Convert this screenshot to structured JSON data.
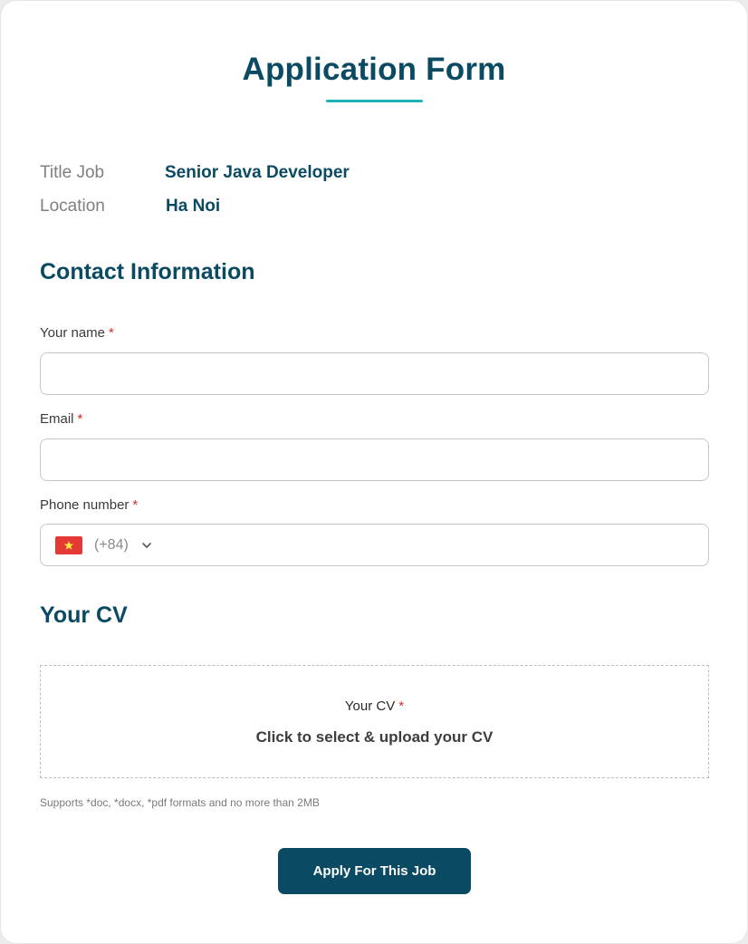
{
  "header": {
    "title": "Application Form"
  },
  "job": {
    "title_label": "Title Job",
    "title_value": "Senior Java Developer",
    "location_label": "Location",
    "location_value": "Ha Noi"
  },
  "contact": {
    "heading": "Contact Information",
    "name_label": "Your name",
    "email_label": "Email",
    "phone_label": "Phone number",
    "required_mark": "*",
    "name_value": "",
    "email_value": "",
    "phone_value": "",
    "country_flag": "vietnam-flag-icon",
    "dial_code": "(+84)"
  },
  "cv": {
    "heading": "Your CV",
    "upload_label": "Your CV",
    "upload_cta": "Click to select & upload your CV",
    "hint": "Supports *doc, *docx, *pdf formats and no more than 2MB"
  },
  "actions": {
    "apply_label": "Apply For This Job"
  },
  "colors": {
    "primary": "#0b4a63",
    "accent": "#1fb2b8",
    "required": "#d32f2f"
  }
}
